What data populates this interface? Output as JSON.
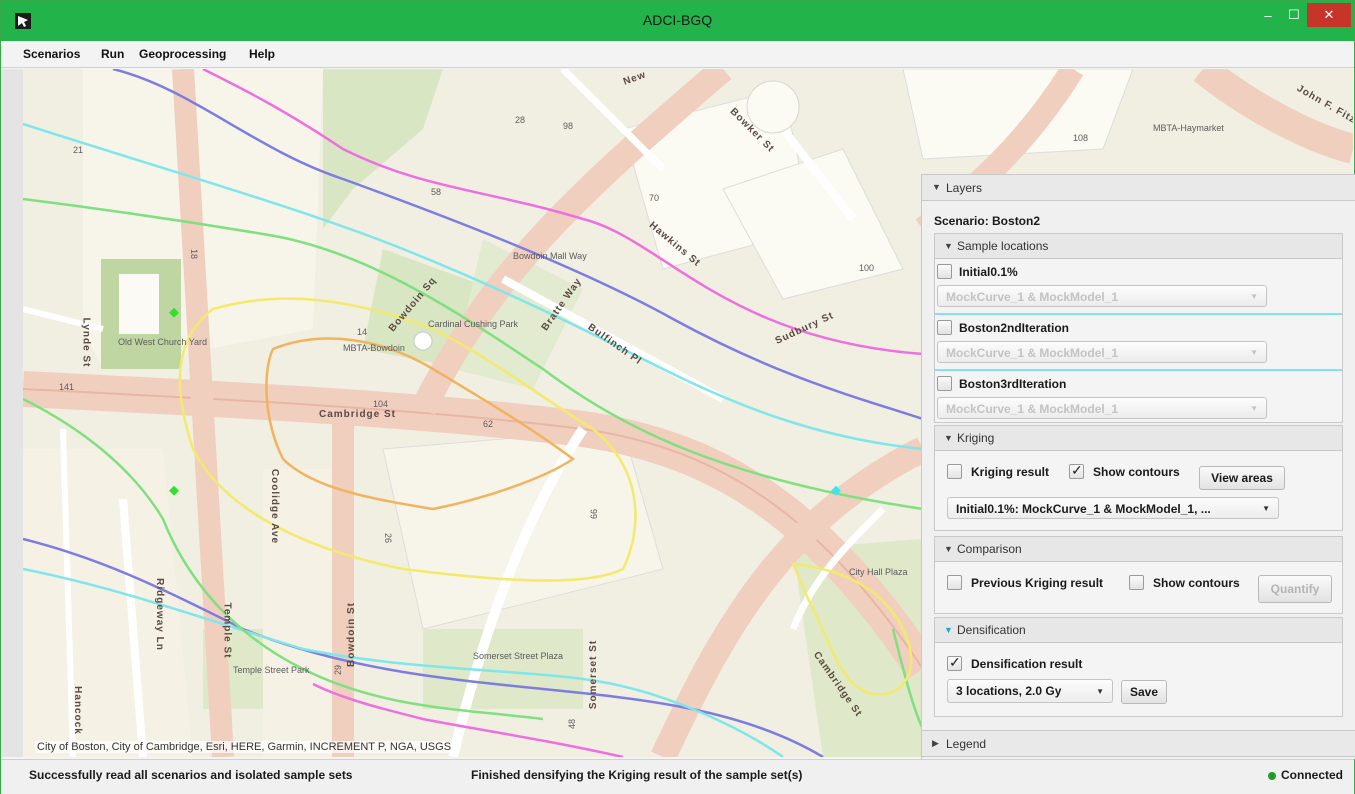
{
  "window": {
    "title": "ADCI-BGQ",
    "minimize_glyph": "‒",
    "maximize_glyph": "☐",
    "close_glyph": "✕"
  },
  "menu": [
    "Scenarios",
    "Run",
    "Geoprocessing",
    "Help"
  ],
  "map": {
    "attribution": "City of Boston, City of Cambridge, Esri, HERE, Garmin, INCREMENT P, NGA, USGS",
    "place_labels": [
      "Old West Church Yard",
      "MBTA-Bowdoin",
      "Cardinal Cushing Park",
      "Bowdoin Mall Way",
      "City Hall Plaza",
      "Somerset Street Plaza",
      "Temple Street Park",
      "MBTA-Haymarket"
    ],
    "street_labels": [
      "Cambridge St",
      "Bowdoin Sq",
      "Bowdoin St",
      "Coolidge Ave",
      "Ridgeway Ln",
      "Temple St",
      "Somerset St",
      "Bulfinch Pl",
      "Hawkins St",
      "Bowker St",
      "Sudbury St",
      "Lynde St",
      "Hancock",
      "Cambridge St",
      "John F. Fitz",
      "New",
      "Bratte Way"
    ],
    "numbers": [
      "21",
      "18",
      "141",
      "104",
      "62",
      "14",
      "29",
      "66",
      "48",
      "100",
      "108",
      "98",
      "70",
      "28",
      "58",
      "26"
    ]
  },
  "panel": {
    "layers_title": "Layers",
    "scenario_label": "Scenario: Boston2",
    "sample_locations": {
      "title": "Sample locations",
      "items": [
        {
          "name": "Initial0.1%",
          "checked": false,
          "select": "MockCurve_1 & MockModel_1"
        },
        {
          "name": "Boston2ndIteration",
          "checked": false,
          "select": "MockCurve_1 & MockModel_1"
        },
        {
          "name": "Boston3rdIteration",
          "checked": false,
          "select": "MockCurve_1 & MockModel_1"
        }
      ]
    },
    "kriging": {
      "title": "Kriging",
      "result_label": "Kriging result",
      "result_checked": false,
      "contours_label": "Show contours",
      "contours_checked": true,
      "view_areas": "View areas",
      "select": "Initial0.1%: MockCurve_1 & MockModel_1, ..."
    },
    "comparison": {
      "title": "Comparison",
      "previous_label": "Previous Kriging result",
      "contours_label": "Show contours",
      "quantify": "Quantify"
    },
    "densification": {
      "title": "Densification",
      "result_label": "Densification result",
      "result_checked": true,
      "select": "3 locations, 2.0 Gy",
      "save": "Save"
    },
    "legend_title": "Legend"
  },
  "status": {
    "left": "Successfully read all scenarios and isolated sample sets",
    "middle": "Finished densifying the Kriging result of the sample set(s)",
    "connection": "Connected",
    "connection_color": "#1f9a2e"
  },
  "colors": {
    "titlebar": "#22b34a",
    "close_button": "#c7352a"
  }
}
